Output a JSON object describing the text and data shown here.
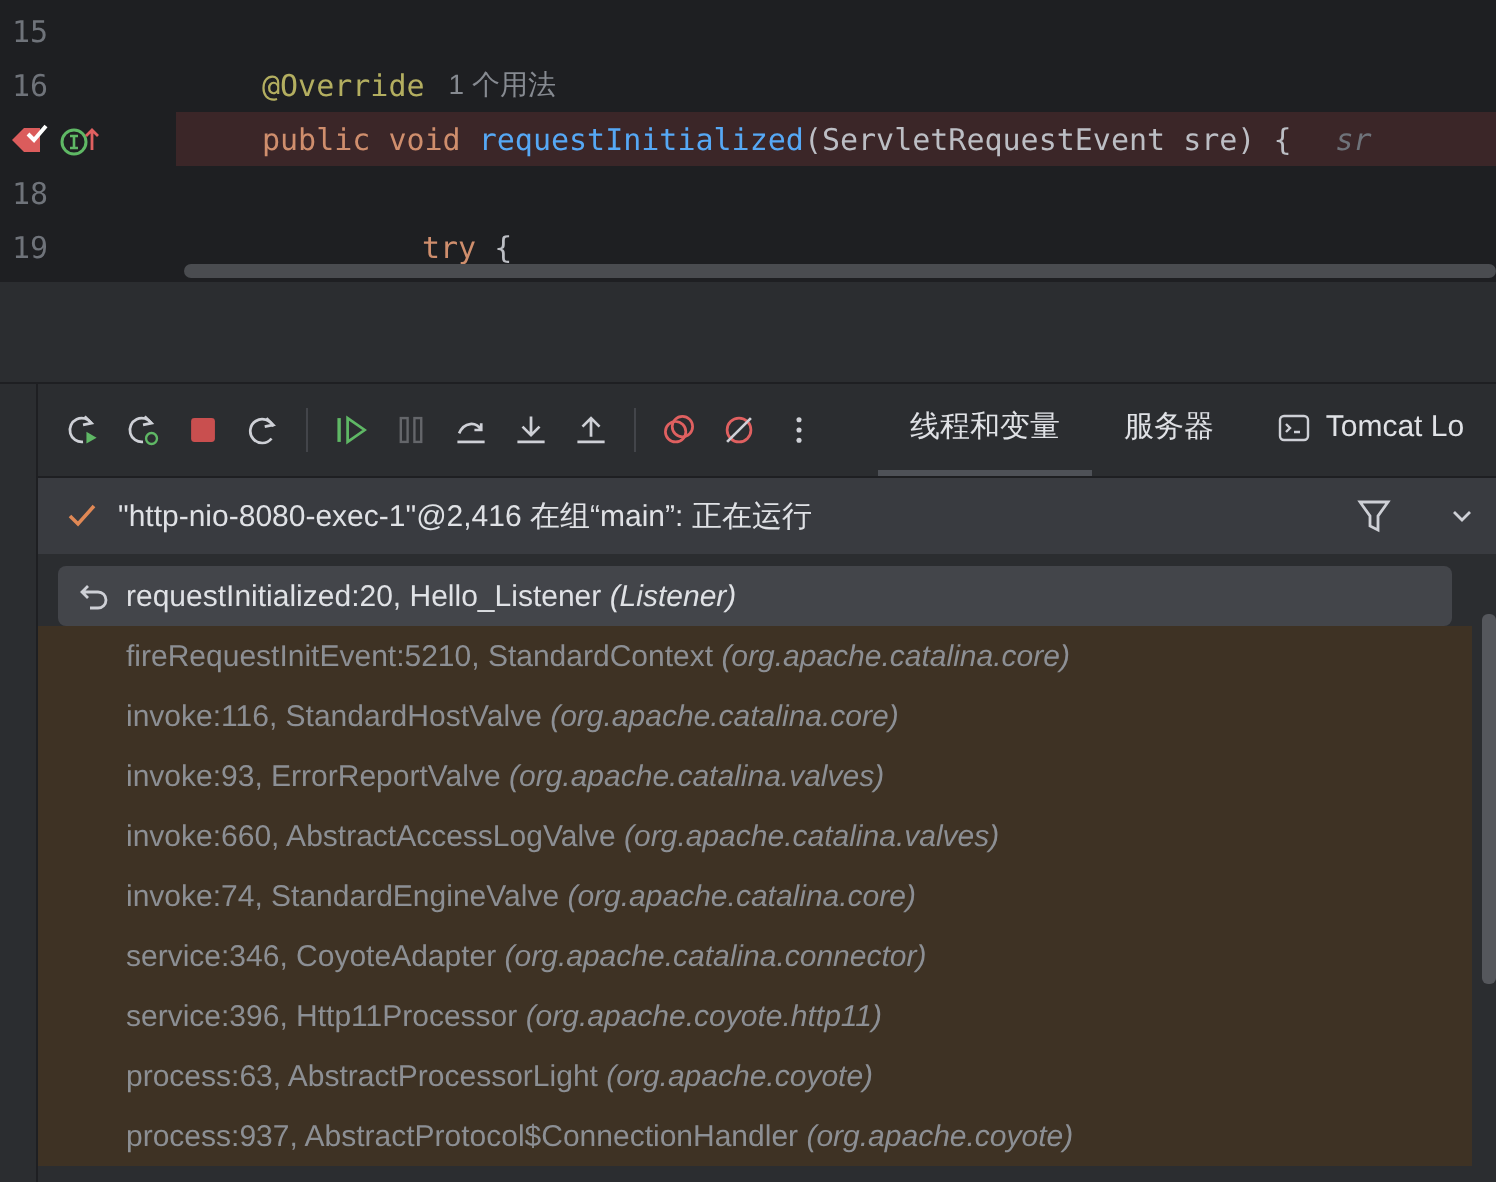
{
  "editor": {
    "lines": [
      {
        "number": "15",
        "breakpoint": false
      },
      {
        "number": "16",
        "breakpoint": false,
        "tokens": [
          {
            "kind": "annotation",
            "text": "@Override"
          },
          {
            "kind": "usage",
            "text": "1 个用法"
          }
        ]
      },
      {
        "breakpoint": true,
        "tokens": [
          {
            "kind": "keyword",
            "text": "public void "
          },
          {
            "kind": "method",
            "text": "requestInitialized"
          },
          {
            "kind": "plain",
            "text": "(ServletRequestEvent sre) {"
          },
          {
            "kind": "hint",
            "text": "sr"
          }
        ],
        "children": [
          {
            "number": "18",
            "breakpoint": false
          },
          {
            "number": "19",
            "breakpoint": false,
            "tokens": [
              {
                "kind": "keyword",
                "text": "try "
              },
              {
                "kind": "plain",
                "text": "{"
              }
            ]
          }
        ]
      }
    ]
  },
  "toolbar": {
    "buttons": [
      {
        "kind": "rerun",
        "disabled": false
      },
      {
        "kind": "rerun-debug",
        "disabled": false
      },
      {
        "kind": "stop",
        "disabled": false
      },
      {
        "kind": "restart",
        "disabled": false
      },
      {
        "kind": "sep"
      },
      {
        "kind": "resume",
        "disabled": false
      },
      {
        "kind": "pause",
        "disabled": true
      },
      {
        "kind": "step-over",
        "disabled": false
      },
      {
        "kind": "step-into",
        "disabled": false
      },
      {
        "kind": "step-out",
        "disabled": false
      },
      {
        "kind": "sep"
      },
      {
        "kind": "breakpoints",
        "disabled": false
      },
      {
        "kind": "mute",
        "disabled": false
      },
      {
        "kind": "more",
        "disabled": false
      }
    ],
    "tabs": [
      {
        "label": "线程和变量",
        "selected": true,
        "kind": "plain"
      },
      {
        "label": "服务器",
        "selected": false,
        "kind": "plain"
      },
      {
        "label": "Tomcat Lo",
        "selected": false,
        "kind": "console"
      }
    ]
  },
  "thread": {
    "text": "\"http-nio-8080-exec-1\"@2,416 在组“main”: 正在运行"
  },
  "frames": [
    {
      "text": "requestInitialized:20, Hello_Listener",
      "package": "(Listener)",
      "selected": true,
      "kind": "user"
    },
    {
      "text": "fireRequestInitEvent:5210, StandardContext",
      "package": "(org.apache.catalina.core)",
      "selected": false,
      "kind": "library"
    },
    {
      "text": "invoke:116, StandardHostValve",
      "package": "(org.apache.catalina.core)",
      "selected": false,
      "kind": "library"
    },
    {
      "text": "invoke:93, ErrorReportValve",
      "package": "(org.apache.catalina.valves)",
      "selected": false,
      "kind": "library"
    },
    {
      "text": "invoke:660, AbstractAccessLogValve",
      "package": "(org.apache.catalina.valves)",
      "selected": false,
      "kind": "library"
    },
    {
      "text": "invoke:74, StandardEngineValve",
      "package": "(org.apache.catalina.core)",
      "selected": false,
      "kind": "library"
    },
    {
      "text": "service:346, CoyoteAdapter",
      "package": "(org.apache.catalina.connector)",
      "selected": false,
      "kind": "library"
    },
    {
      "text": "service:396, Http11Processor",
      "package": "(org.apache.coyote.http11)",
      "selected": false,
      "kind": "library"
    },
    {
      "text": "process:63, AbstractProcessorLight",
      "package": "(org.apache.coyote)",
      "selected": false,
      "kind": "library"
    },
    {
      "text": "process:937, AbstractProtocol$ConnectionHandler",
      "package": "(org.apache.coyote)",
      "selected": false,
      "kind": "library"
    }
  ]
}
